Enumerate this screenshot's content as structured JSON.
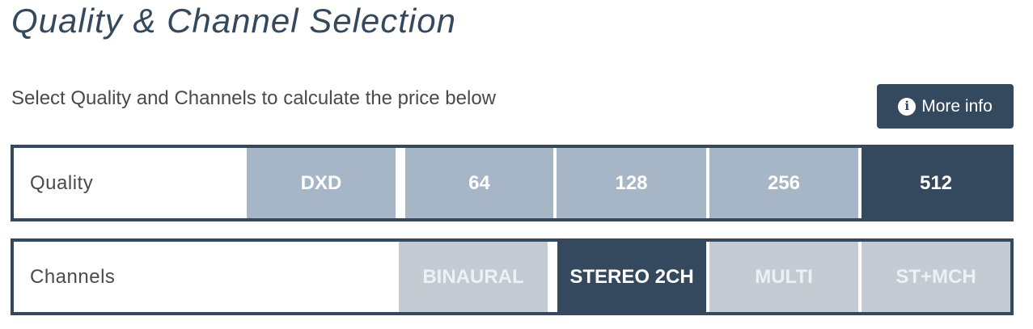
{
  "page_title": "Quality & Channel Selection",
  "instruction": "Select Quality and Channels to calculate the price below",
  "more_info": {
    "label": "More info",
    "icon": "info-icon",
    "icon_glyph": "i"
  },
  "quality": {
    "label": "Quality",
    "options": [
      "DXD",
      "64",
      "128",
      "256",
      "512"
    ],
    "selected": "512"
  },
  "channels": {
    "label": "Channels",
    "options": [
      "BINAURAL",
      "STEREO 2CH",
      "MULTI",
      "ST+MCH"
    ],
    "selected": "STEREO 2CH"
  },
  "colors": {
    "primary": "#34495e",
    "quality_inactive": "#a7b6c6",
    "channel_inactive": "#c5cbd2",
    "text": "#4a4a4a"
  }
}
